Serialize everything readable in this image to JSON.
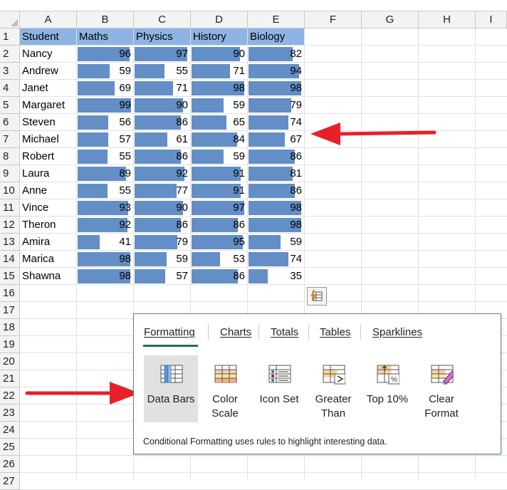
{
  "columns": [
    "A",
    "B",
    "C",
    "D",
    "E",
    "F",
    "G",
    "H",
    "I"
  ],
  "rows": [
    "1",
    "2",
    "3",
    "4",
    "5",
    "6",
    "7",
    "8",
    "9",
    "10",
    "11",
    "12",
    "13",
    "14",
    "15",
    "16",
    "17",
    "18",
    "19",
    "20",
    "21",
    "22",
    "23",
    "24",
    "25",
    "26",
    "27"
  ],
  "table": {
    "headers": [
      "Student",
      "Maths",
      "Physics",
      "History",
      "Biology"
    ],
    "students": [
      {
        "name": "Nancy",
        "scores": [
          96,
          97,
          90,
          82
        ]
      },
      {
        "name": "Andrew",
        "scores": [
          59,
          55,
          71,
          94
        ]
      },
      {
        "name": "Janet",
        "scores": [
          69,
          71,
          98,
          98
        ]
      },
      {
        "name": "Margaret",
        "scores": [
          99,
          90,
          59,
          79
        ]
      },
      {
        "name": "Steven",
        "scores": [
          56,
          86,
          65,
          74
        ]
      },
      {
        "name": "Michael",
        "scores": [
          57,
          61,
          84,
          67
        ]
      },
      {
        "name": "Robert",
        "scores": [
          55,
          86,
          59,
          86
        ]
      },
      {
        "name": "Laura",
        "scores": [
          89,
          92,
          91,
          81
        ]
      },
      {
        "name": "Anne",
        "scores": [
          55,
          77,
          91,
          86
        ]
      },
      {
        "name": "Vince",
        "scores": [
          93,
          90,
          97,
          98
        ]
      },
      {
        "name": "Theron",
        "scores": [
          92,
          86,
          86,
          98
        ]
      },
      {
        "name": "Amira",
        "scores": [
          41,
          79,
          95,
          59
        ]
      },
      {
        "name": "Marica",
        "scores": [
          98,
          59,
          53,
          74
        ]
      },
      {
        "name": "Shawna",
        "scores": [
          98,
          57,
          86,
          35
        ]
      }
    ]
  },
  "quick_analysis": {
    "tabs": [
      "Formatting",
      "Charts",
      "Totals",
      "Tables",
      "Sparklines"
    ],
    "active_tab": "Formatting",
    "options": [
      {
        "label1": "Data Bars",
        "label2": "",
        "icon": "data-bars-icon"
      },
      {
        "label1": "Color",
        "label2": "Scale",
        "icon": "color-scale-icon"
      },
      {
        "label1": "Icon Set",
        "label2": "",
        "icon": "icon-set-icon"
      },
      {
        "label1": "Greater",
        "label2": "Than",
        "icon": "greater-than-icon"
      },
      {
        "label1": "Top 10%",
        "label2": "",
        "icon": "top-10-percent-icon"
      },
      {
        "label1": "Clear",
        "label2": "Format",
        "icon": "clear-format-icon"
      }
    ],
    "selected_option": "Data Bars",
    "description": "Conditional Formatting uses rules to highlight interesting data."
  },
  "colors": {
    "bar": "#638ec6",
    "header_fill": "#8eb4e3",
    "arrow": "#e8202a",
    "accent": "#217346"
  }
}
